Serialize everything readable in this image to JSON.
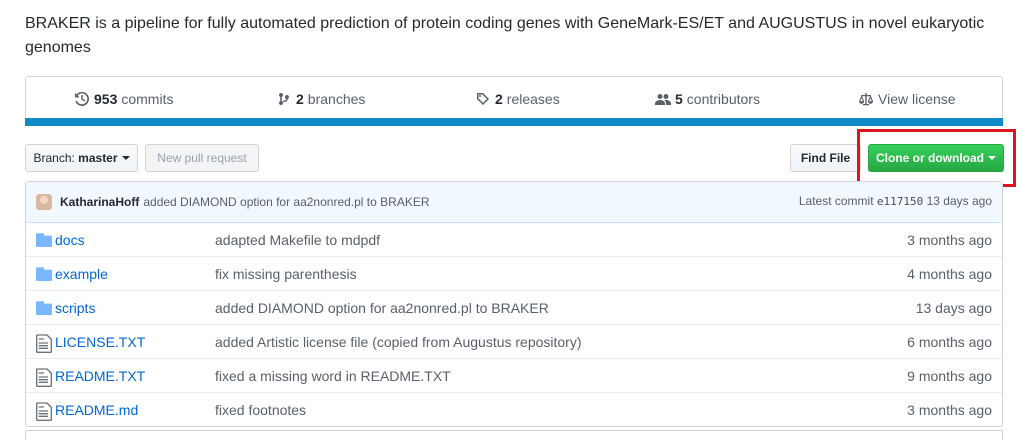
{
  "description": "BRAKER is a pipeline for fully automated prediction of protein coding genes with GeneMark-ES/ET and AUGUSTUS in novel eukaryotic genomes",
  "stats": {
    "commits_count": "953",
    "commits_label": "commits",
    "branches_count": "2",
    "branches_label": "branches",
    "releases_count": "2",
    "releases_label": "releases",
    "contributors_count": "5",
    "contributors_label": "contributors",
    "license_label": "View license"
  },
  "toolbar": {
    "branch_prefix": "Branch:",
    "branch_name": "master",
    "new_pull_request": "New pull request",
    "find_file": "Find File",
    "clone_or_download": "Clone or download"
  },
  "commit": {
    "author": "KatharinaHoff",
    "message": "added DIAMOND option for aa2nonred.pl to BRAKER",
    "latest_label": "Latest commit",
    "sha": "e117150",
    "age": "13 days ago"
  },
  "files": [
    {
      "type": "folder",
      "name": "docs",
      "message": "adapted Makefile to mdpdf",
      "age": "3 months ago"
    },
    {
      "type": "folder",
      "name": "example",
      "message": "fix missing parenthesis",
      "age": "4 months ago"
    },
    {
      "type": "folder",
      "name": "scripts",
      "message": "added DIAMOND option for aa2nonred.pl to BRAKER",
      "age": "13 days ago"
    },
    {
      "type": "file",
      "name": "LICENSE.TXT",
      "message": "added Artistic license file (copied from Augustus repository)",
      "age": "6 months ago"
    },
    {
      "type": "file",
      "name": "README.TXT",
      "message": "fixed a missing word in README.TXT",
      "age": "9 months ago"
    },
    {
      "type": "file",
      "name": "README.md",
      "message": "fixed footnotes",
      "age": "3 months ago"
    }
  ],
  "colors": {
    "accent": "#0366d6",
    "green": "#28a745",
    "highlight": "#e0141e",
    "bar": "#0e8bc7"
  }
}
